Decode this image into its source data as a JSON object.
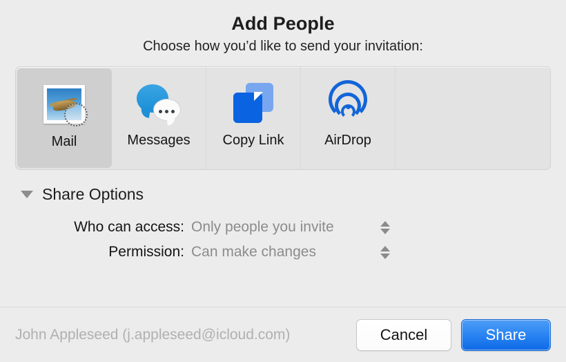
{
  "dialog": {
    "title": "Add People",
    "subtitle": "Choose how you’d like to send your invitation:"
  },
  "share_methods": [
    {
      "label": "Mail",
      "icon": "mail-stamp-icon",
      "selected": true
    },
    {
      "label": "Messages",
      "icon": "messages-bubble-icon",
      "selected": false
    },
    {
      "label": "Copy Link",
      "icon": "copy-link-documents-icon",
      "selected": false
    },
    {
      "label": "AirDrop",
      "icon": "airdrop-waves-icon",
      "selected": false
    }
  ],
  "share_options": {
    "section_label": "Share Options",
    "expanded": true,
    "rows": [
      {
        "label": "Who can access:",
        "value": "Only people you invite"
      },
      {
        "label": "Permission:",
        "value": "Can make changes"
      }
    ]
  },
  "footer": {
    "account": "John Appleseed (j.appleseed@icloud.com)",
    "cancel_label": "Cancel",
    "share_label": "Share"
  },
  "colors": {
    "window_background": "#ececec",
    "picker_background": "#e3e3e3",
    "selected_cell": "#cfcfcf",
    "accent_blue": "#2a84f2",
    "airdrop_blue": "#1265d8",
    "copy_link_blue": "#0a63e0",
    "messages_blue": "#1b8fd6",
    "muted_text": "#8b8b8b"
  }
}
